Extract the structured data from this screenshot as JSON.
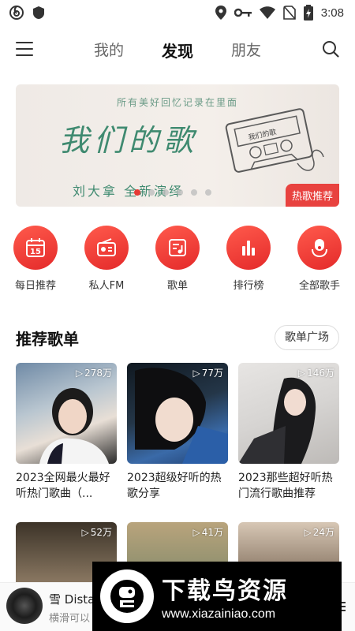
{
  "status_bar": {
    "time": "3:08"
  },
  "top_nav": {
    "tabs": [
      "我的",
      "发现",
      "朋友"
    ],
    "active_tab": "发现"
  },
  "banner": {
    "top_text": "所有美好回忆记录在里面",
    "title": "我们的歌",
    "subtitle": "刘大拿 全新演绎",
    "cassette_label": "我们的歌",
    "badge": "热歌推荐",
    "dots_total": 6,
    "dot_active": 0
  },
  "quick_entries": [
    {
      "label": "每日推荐",
      "icon": "calendar-icon",
      "day": "15"
    },
    {
      "label": "私人FM",
      "icon": "radio-icon"
    },
    {
      "label": "歌单",
      "icon": "playlist-icon"
    },
    {
      "label": "排行榜",
      "icon": "chart-bars-icon"
    },
    {
      "label": "全部歌手",
      "icon": "singer-icon"
    }
  ],
  "recommend": {
    "title": "推荐歌单",
    "square_button": "歌单广场",
    "playlists": [
      {
        "count": "278万",
        "title": "2023全网最火最好听热门歌曲（..."
      },
      {
        "count": "77万",
        "title": "2023超级好听的热歌分享"
      },
      {
        "count": "146万",
        "title": "2023那些超好听热门流行歌曲推荐"
      },
      {
        "count": "52万",
        "title": ""
      },
      {
        "count": "41万",
        "title": ""
      },
      {
        "count": "24万",
        "title": ""
      }
    ]
  },
  "mini_player": {
    "title": "雪 Dista",
    "subtitle": "横滑可以"
  },
  "watermark": {
    "name": "下载鸟资源",
    "url": "www.xiazainiao.com"
  },
  "colors": {
    "accent": "#e8423f",
    "text": "#222222",
    "banner_green": "#3f8a70"
  }
}
